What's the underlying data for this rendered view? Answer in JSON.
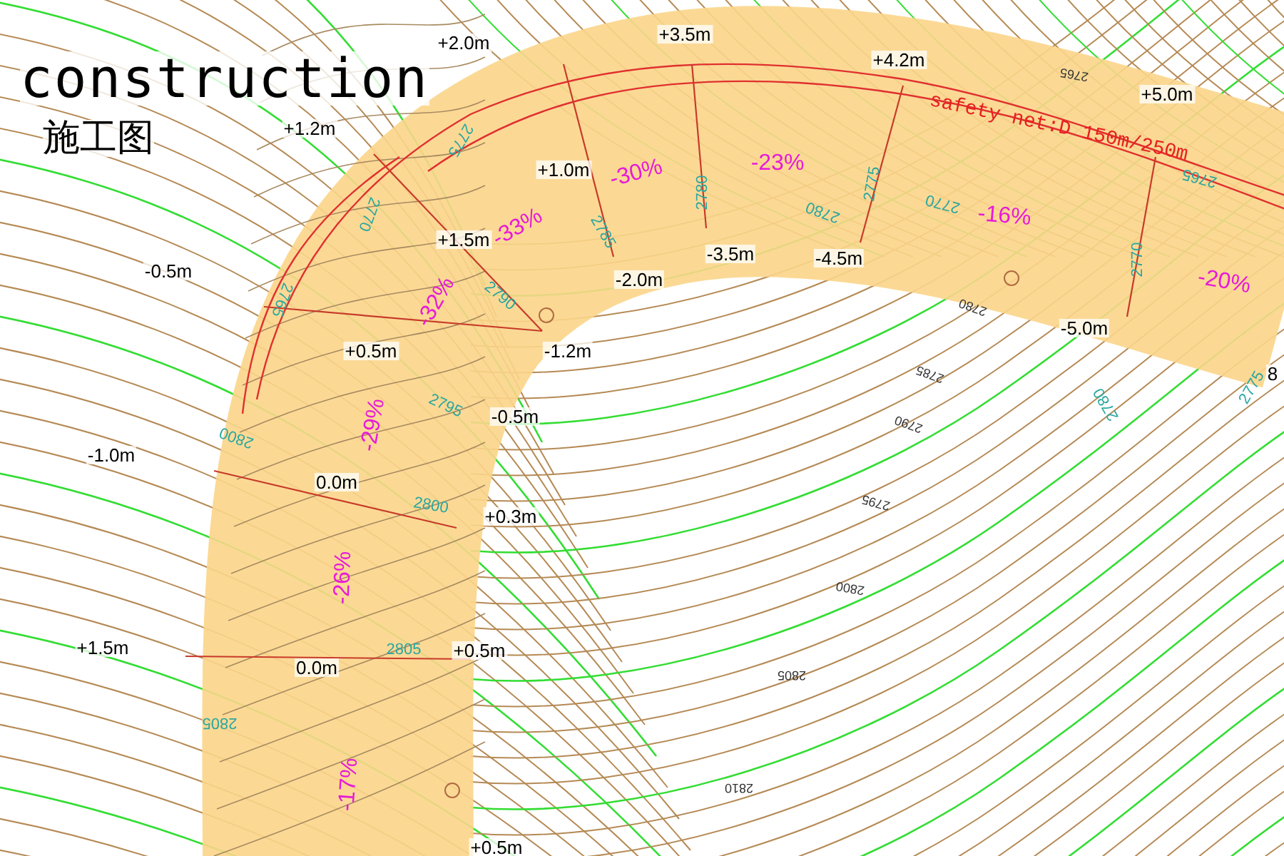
{
  "title": "construction",
  "subtitle": "施工图",
  "note": {
    "text": "safety net:D 150m/250m"
  },
  "elevation_marks": [
    {
      "text": "+2.0m"
    },
    {
      "text": "+3.5m"
    },
    {
      "text": "+4.2m"
    },
    {
      "text": "+5.0m"
    },
    {
      "text": "+1.2m"
    },
    {
      "text": "+1.0m"
    },
    {
      "text": "+1.5m"
    },
    {
      "text": "-0.5m"
    },
    {
      "text": "-2.0m"
    },
    {
      "text": "-3.5m"
    },
    {
      "text": "-4.5m"
    },
    {
      "text": "-5.0m"
    },
    {
      "text": "+0.5m"
    },
    {
      "text": "-1.2m"
    },
    {
      "text": "-0.5m"
    },
    {
      "text": "-1.0m"
    },
    {
      "text": "0.0m"
    },
    {
      "text": "+0.3m"
    },
    {
      "text": "+1.5m"
    },
    {
      "text": "0.0m"
    },
    {
      "text": "+0.5m"
    },
    {
      "text": "+0.5m"
    },
    {
      "text": "8"
    }
  ],
  "slope_marks": [
    {
      "text": "-30%"
    },
    {
      "text": "-23%"
    },
    {
      "text": "-33%"
    },
    {
      "text": "-16%"
    },
    {
      "text": "-32%"
    },
    {
      "text": "-20%"
    },
    {
      "text": "-29%"
    },
    {
      "text": "-26%"
    },
    {
      "text": "-17%"
    }
  ],
  "contour_labels": [
    {
      "text": "2775",
      "kind": "design"
    },
    {
      "text": "2770",
      "kind": "design"
    },
    {
      "text": "2765",
      "kind": "design"
    },
    {
      "text": "2780",
      "kind": "design"
    },
    {
      "text": "2785",
      "kind": "design"
    },
    {
      "text": "2790",
      "kind": "design"
    },
    {
      "text": "2795",
      "kind": "design"
    },
    {
      "text": "2800",
      "kind": "design"
    },
    {
      "text": "2800",
      "kind": "design"
    },
    {
      "text": "2805",
      "kind": "design"
    },
    {
      "text": "2805",
      "kind": "design"
    },
    {
      "text": "2780",
      "kind": "design"
    },
    {
      "text": "2775",
      "kind": "design"
    },
    {
      "text": "2770",
      "kind": "design"
    },
    {
      "text": "2770",
      "kind": "design"
    },
    {
      "text": "2765",
      "kind": "design"
    },
    {
      "text": "2775",
      "kind": "design"
    },
    {
      "text": "2780",
      "kind": "design"
    },
    {
      "text": "2765",
      "kind": "terrain"
    },
    {
      "text": "2780",
      "kind": "terrain"
    },
    {
      "text": "2785",
      "kind": "terrain"
    },
    {
      "text": "2790",
      "kind": "terrain"
    },
    {
      "text": "2795",
      "kind": "terrain"
    },
    {
      "text": "2800",
      "kind": "terrain"
    },
    {
      "text": "2805",
      "kind": "terrain"
    },
    {
      "text": "2810",
      "kind": "terrain"
    }
  ]
}
